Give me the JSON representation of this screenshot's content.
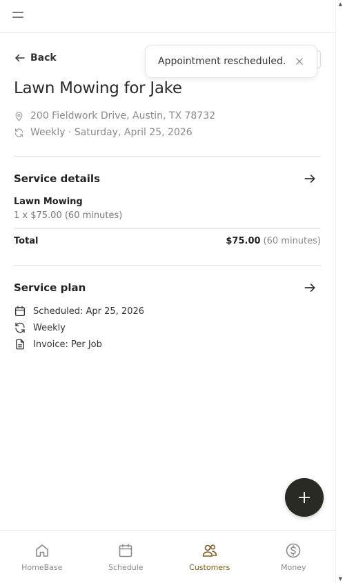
{
  "nav": {
    "back_label": "Back"
  },
  "page": {
    "title": "Lawn Mowing for Jake",
    "address": "200 Fieldwork Drive, Austin, TX 78732",
    "recurrence": "Weekly · Saturday, April 25, 2026"
  },
  "service_details": {
    "title": "Service details",
    "item_name": "Lawn Mowing",
    "item_detail": "1 x $75.00 (60 minutes)",
    "total_label": "Total",
    "total_amount": "$75.00",
    "total_duration": "(60 minutes)"
  },
  "service_plan": {
    "title": "Service plan",
    "rows": [
      {
        "icon": "calendar-icon",
        "text": "Scheduled: Apr 25, 2026"
      },
      {
        "icon": "repeat-icon",
        "text": "Weekly"
      },
      {
        "icon": "document-icon",
        "text": "Invoice: Per Job"
      }
    ]
  },
  "toast": {
    "message": "Appointment rescheduled."
  },
  "bottom_nav": [
    {
      "label": "HomeBase",
      "icon": "home-icon",
      "active": false
    },
    {
      "label": "Schedule",
      "icon": "calendar-icon",
      "active": false
    },
    {
      "label": "Customers",
      "icon": "users-icon",
      "active": true
    },
    {
      "label": "Money",
      "icon": "dollar-icon",
      "active": false
    }
  ],
  "colors": {
    "accent": "#7a5a1c",
    "fab": "#2a2a24",
    "muted_text": "#8a8a8a"
  }
}
